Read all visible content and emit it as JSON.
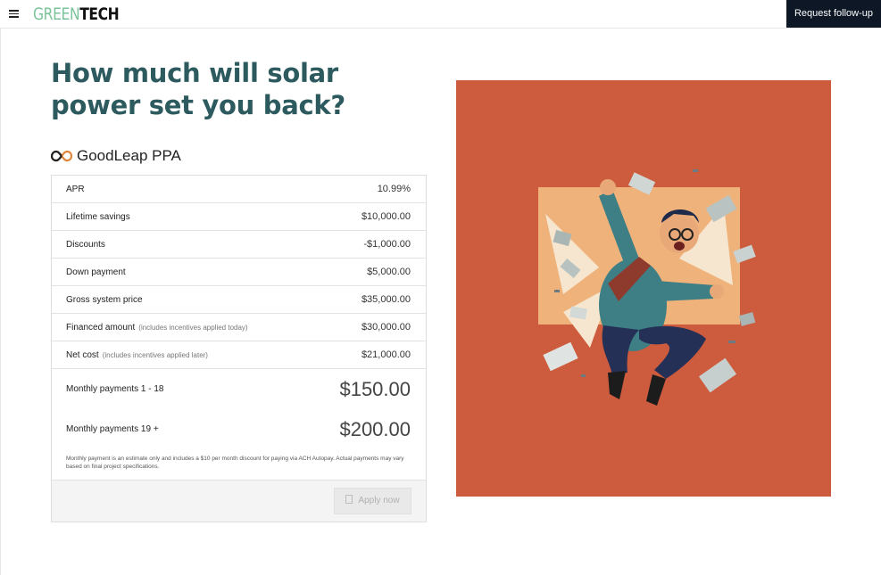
{
  "header": {
    "logo_green": "GREEN",
    "logo_dark": "TECH",
    "followup_label": "Request follow-up"
  },
  "page": {
    "title": "How much will solar power set you back?",
    "plan_name": "GoodLeap PPA"
  },
  "rows": [
    {
      "label": "APR",
      "note": "",
      "value": "10.99%"
    },
    {
      "label": "Lifetime savings",
      "note": "",
      "value": "$10,000.00"
    },
    {
      "label": "Discounts",
      "note": "",
      "value": "-$1,000.00"
    },
    {
      "label": "Down payment",
      "note": "",
      "value": "$5,000.00"
    },
    {
      "label": "Gross system price",
      "note": "",
      "value": "$35,000.00"
    },
    {
      "label": "Financed amount",
      "note": "(includes incentives applied today)",
      "value": "$30,000.00"
    },
    {
      "label": "Net cost",
      "note": "(includes incentives applied later)",
      "value": "$21,000.00"
    }
  ],
  "payments": [
    {
      "label": "Monthly payments 1 - 18",
      "amount": "$150.00"
    },
    {
      "label": "Monthly payments 19 +",
      "amount": "$200.00"
    }
  ],
  "disclaimer": "Monthly payment is an estimate only and includes a $10 per month discount for paying via ACH Autopay. Actual payments may vary based on final project specifications.",
  "apply_label": "Apply now",
  "colors": {
    "accent": "#2d5a5e",
    "logo_green": "#7bc39a",
    "illustration_bg": "#cd5b3d",
    "followup_bg": "#0d1726"
  },
  "icons": {
    "menu": "hamburger-icon",
    "plan": "infinity-logo-icon",
    "apply": "document-icon"
  }
}
